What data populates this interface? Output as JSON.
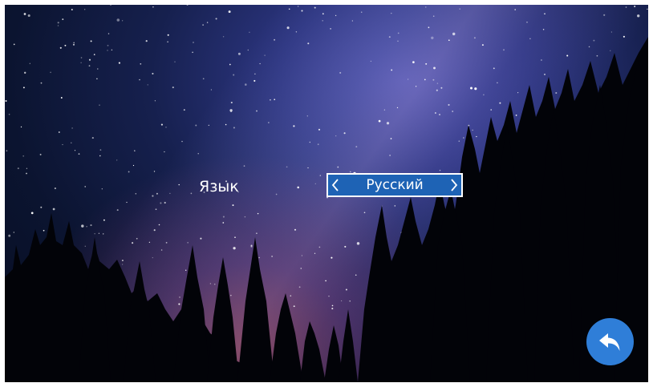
{
  "settings": {
    "language_label": "Язык",
    "language_value": "Русский"
  },
  "controls": {
    "prev_icon": "chevron-left-icon",
    "next_icon": "chevron-right-icon",
    "back_icon": "back-arrow-icon"
  },
  "colors": {
    "selector_background": "#1e63b5",
    "selector_border": "#ffffff",
    "back_button": "#2f7ed8",
    "text": "#ffffff"
  }
}
